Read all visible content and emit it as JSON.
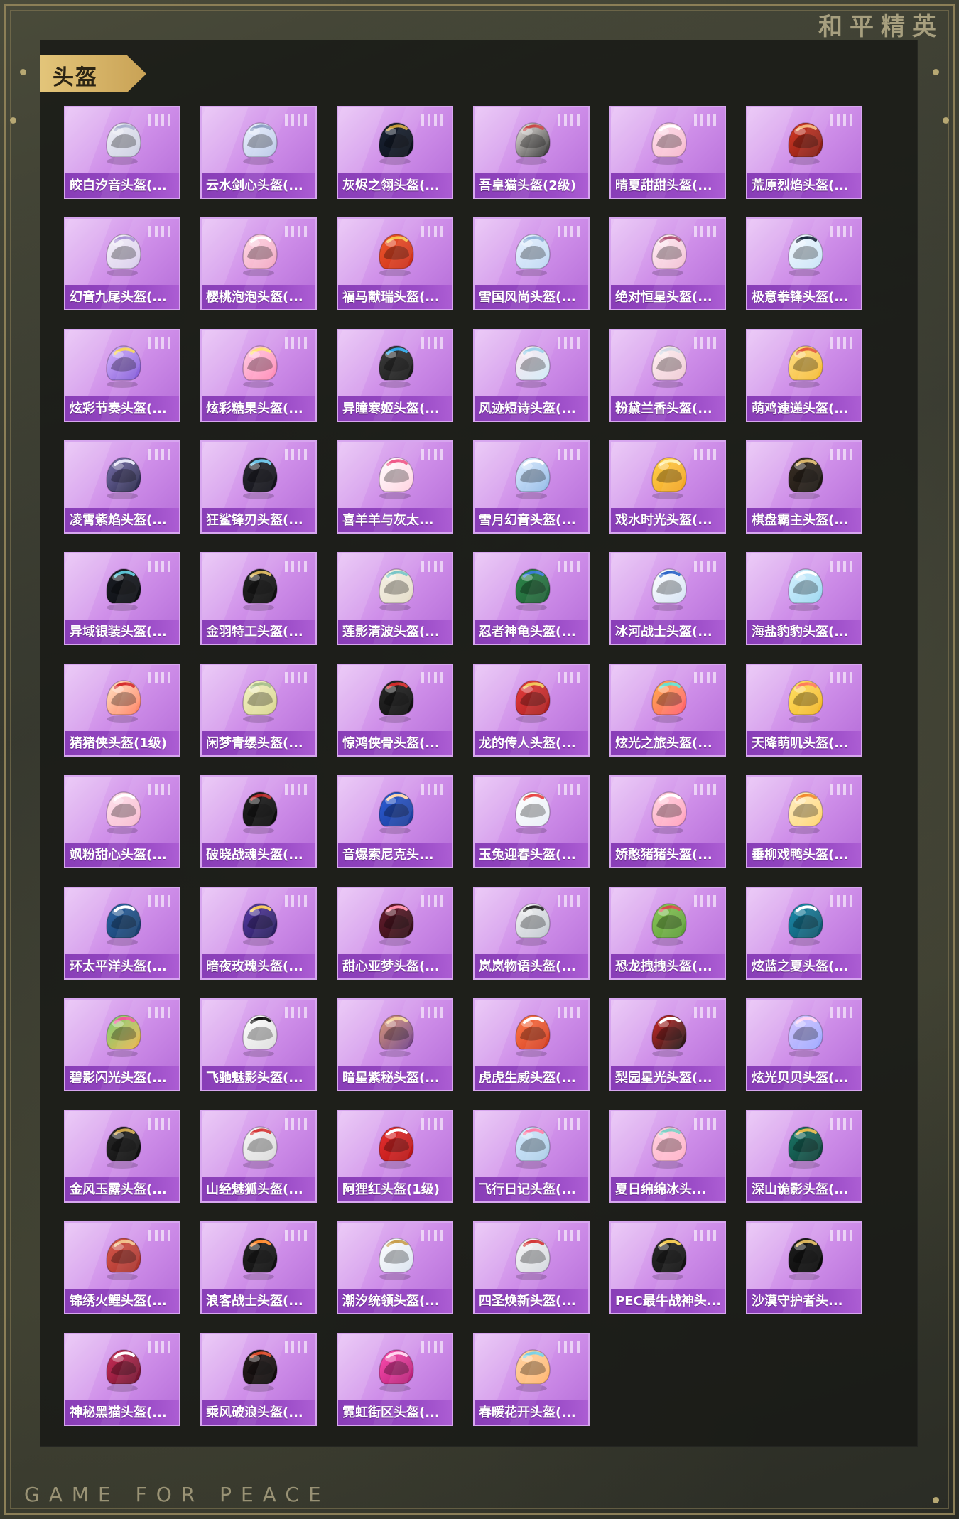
{
  "brand": {
    "title_cn": "和平精英",
    "footer_en": "GAME FOR PEACE"
  },
  "section": {
    "title": "头盔"
  },
  "cards": [
    {
      "name": "皎白汐音头盔(...",
      "icon": "helmet-icon",
      "c1": "#f0f0f6",
      "c2": "#c8cce0",
      "acc": "#aab2d0"
    },
    {
      "name": "云水剑心头盔(...",
      "icon": "helmet-icon",
      "c1": "#eef3ff",
      "c2": "#b7c6e6",
      "acc": "#8da0c4"
    },
    {
      "name": "灰烬之翎头盔(...",
      "icon": "helmet-icon",
      "c1": "#1b2436",
      "c2": "#0a0f18",
      "acc": "#c49a3c"
    },
    {
      "name": "吾皇猫头盔(2级)",
      "icon": "helmet-icon",
      "c1": "#f3eee9",
      "c2": "#2b2b2b",
      "acc": "#c94949"
    },
    {
      "name": "晴夏甜甜头盔(...",
      "icon": "helmet-icon",
      "c1": "#ffe1ec",
      "c2": "#f6b5cb",
      "acc": "#ffffff"
    },
    {
      "name": "荒原烈焰头盔(...",
      "icon": "helmet-icon",
      "c1": "#d93a26",
      "c2": "#7a1a12",
      "acc": "#f2b27a"
    },
    {
      "name": "幻音九尾头盔(...",
      "icon": "helmet-icon",
      "c1": "#f7f4fa",
      "c2": "#d6c9ea",
      "acc": "#a993d6"
    },
    {
      "name": "樱桃泡泡头盔(...",
      "icon": "helmet-icon",
      "c1": "#ffd9e6",
      "c2": "#f2a5c1",
      "acc": "#ffffff"
    },
    {
      "name": "福马献瑞头盔(...",
      "icon": "helmet-icon",
      "c1": "#ef5a2e",
      "c2": "#c92a16",
      "acc": "#f6c34a"
    },
    {
      "name": "雪国风尚头盔(...",
      "icon": "helmet-icon",
      "c1": "#eaf3ff",
      "c2": "#bcd6f3",
      "acc": "#8fb2d9"
    },
    {
      "name": "绝对恒星头盔(...",
      "icon": "helmet-icon",
      "c1": "#fff0f6",
      "c2": "#f2bed2",
      "acc": "#b04f73"
    },
    {
      "name": "极意拳锋头盔(...",
      "icon": "helmet-icon",
      "c1": "#f5faff",
      "c2": "#c7e3f7",
      "acc": "#1b2b3e"
    },
    {
      "name": "炫彩节奏头盔(...",
      "icon": "helmet-icon",
      "c1": "#d7b7ff",
      "c2": "#7f56d6",
      "acc": "#f6d55b"
    },
    {
      "name": "炫彩糖果头盔(...",
      "icon": "helmet-icon",
      "c1": "#ffd0e6",
      "c2": "#ff86b4",
      "acc": "#ffe17a"
    },
    {
      "name": "异瞳寒姬头盔(...",
      "icon": "helmet-icon",
      "c1": "#3f3f3f",
      "c2": "#161616",
      "acc": "#2fa7e8"
    },
    {
      "name": "风迹短诗头盔(...",
      "icon": "helmet-icon",
      "c1": "#ffe9f0",
      "c2": "#cfeaf7",
      "acc": "#9fd2ea"
    },
    {
      "name": "粉黛兰香头盔(...",
      "icon": "helmet-icon",
      "c1": "#fff3f3",
      "c2": "#efc7d3",
      "acc": "#d5dbe6"
    },
    {
      "name": "萌鸡速递头盔(...",
      "icon": "helmet-icon",
      "c1": "#ffe08a",
      "c2": "#f5b92f",
      "acc": "#e45b3a"
    },
    {
      "name": "凌霄紫焰头盔(...",
      "icon": "helmet-icon",
      "c1": "#7c74b0",
      "c2": "#242444",
      "acc": "#e7e7f7"
    },
    {
      "name": "狂鲨锋刃头盔(...",
      "icon": "helmet-icon",
      "c1": "#2b2b33",
      "c2": "#0f0f16",
      "acc": "#6ac2e8"
    },
    {
      "name": "喜羊羊与灰太...",
      "icon": "helmet-icon",
      "c1": "#ffffff",
      "c2": "#ffd1df",
      "acc": "#f05a8a"
    },
    {
      "name": "雪月幻音头盔(...",
      "icon": "helmet-icon",
      "c1": "#dfefff",
      "c2": "#8fb7e6",
      "acc": "#ffffff"
    },
    {
      "name": "戏水时光头盔(...",
      "icon": "helmet-icon",
      "c1": "#ffd24a",
      "c2": "#f2a11f",
      "acc": "#fff2b0"
    },
    {
      "name": "棋盘霸主头盔(...",
      "icon": "helmet-icon",
      "c1": "#3b3026",
      "c2": "#181410",
      "acc": "#d8b46a"
    },
    {
      "name": "异域银装头盔(...",
      "icon": "helmet-icon",
      "c1": "#1c1f26",
      "c2": "#0b0d11",
      "acc": "#58c1d3"
    },
    {
      "name": "金羽特工头盔(...",
      "icon": "helmet-icon",
      "c1": "#262626",
      "c2": "#0c0c0c",
      "acc": "#d6b25a"
    },
    {
      "name": "莲影清波头盔(...",
      "icon": "helmet-icon",
      "c1": "#f6f2e6",
      "c2": "#e3dbc6",
      "acc": "#7ac6c7"
    },
    {
      "name": "忍者神龟头盔(...",
      "icon": "helmet-icon",
      "c1": "#2e8b4c",
      "c2": "#1e5a34",
      "acc": "#3a7bd5"
    },
    {
      "name": "冰河战士头盔(...",
      "icon": "helmet-icon",
      "c1": "#ffffff",
      "c2": "#d3e2f4",
      "acc": "#2f67c9"
    },
    {
      "name": "海盐豹豹头盔(...",
      "icon": "helmet-icon",
      "c1": "#d7f2ff",
      "c2": "#98d6f0",
      "acc": "#ffffff"
    },
    {
      "name": "猪猪侠头盔(1级)",
      "icon": "helmet-icon",
      "c1": "#ffe6c7",
      "c2": "#ff7c5c",
      "acc": "#d62e2e"
    },
    {
      "name": "闲梦青缨头盔(...",
      "icon": "helmet-icon",
      "c1": "#f5f3c9",
      "c2": "#d7d48a",
      "acc": "#a7c08a"
    },
    {
      "name": "惊鸿侠骨头盔(...",
      "icon": "helmet-icon",
      "c1": "#2a2a2a",
      "c2": "#0c0c0c",
      "acc": "#cf2b2b"
    },
    {
      "name": "龙的传人头盔(...",
      "icon": "helmet-icon",
      "c1": "#e83f3f",
      "c2": "#a61c1c",
      "acc": "#f0c65a"
    },
    {
      "name": "炫光之旅头盔(...",
      "icon": "helmet-icon",
      "c1": "#ffb14d",
      "c2": "#ff5a6e",
      "acc": "#67e0d0"
    },
    {
      "name": "天降萌叽头盔(...",
      "icon": "helmet-icon",
      "c1": "#ffe46a",
      "c2": "#f2b322",
      "acc": "#ff7e5a"
    },
    {
      "name": "飒粉甜心头盔(...",
      "icon": "helmet-icon",
      "c1": "#ffe3ec",
      "c2": "#f7b8cf",
      "acc": "#ffffff"
    },
    {
      "name": "破晓战魂头盔(...",
      "icon": "helmet-icon",
      "c1": "#232323",
      "c2": "#090909",
      "acc": "#b92a2a"
    },
    {
      "name": "音爆索尼克头...",
      "icon": "helmet-icon",
      "c1": "#2d5ed8",
      "c2": "#1a3a93",
      "acc": "#ffd4a6"
    },
    {
      "name": "玉兔迎春头盔(...",
      "icon": "helmet-icon",
      "c1": "#ffffff",
      "c2": "#e7eef6",
      "acc": "#e84545"
    },
    {
      "name": "娇憨猪猪头盔(...",
      "icon": "helmet-icon",
      "c1": "#ffd7e2",
      "c2": "#ff9dbb",
      "acc": "#ffffff"
    },
    {
      "name": "垂柳戏鸭头盔(...",
      "icon": "helmet-icon",
      "c1": "#fff0c9",
      "c2": "#ffd36a",
      "acc": "#f28a2f"
    },
    {
      "name": "环太平洋头盔(...",
      "icon": "helmet-icon",
      "c1": "#2c66a6",
      "c2": "#163a66",
      "acc": "#ffffff"
    },
    {
      "name": "暗夜玫瑰头盔(...",
      "icon": "helmet-icon",
      "c1": "#5a3da8",
      "c2": "#221a55",
      "acc": "#f6c95b"
    },
    {
      "name": "甜心亚梦头盔(...",
      "icon": "helmet-icon",
      "c1": "#6b1e2f",
      "c2": "#2a0c13",
      "acc": "#ff8ca7"
    },
    {
      "name": "岚岚物语头盔(...",
      "icon": "helmet-icon",
      "c1": "#f4f4f4",
      "c2": "#bfc6ce",
      "acc": "#2b2b2b"
    },
    {
      "name": "恐龙拽拽头盔(...",
      "icon": "helmet-icon",
      "c1": "#8cc85a",
      "c2": "#5a9a35",
      "acc": "#d94a4a"
    },
    {
      "name": "炫蓝之夏头盔(...",
      "icon": "helmet-icon",
      "c1": "#1c8fb0",
      "c2": "#0e4f64",
      "acc": "#ffffff"
    },
    {
      "name": "碧影闪光头盔(...",
      "icon": "helmet-icon",
      "c1": "#7ad07a",
      "c2": "#f0b34a",
      "acc": "#f05a9a"
    },
    {
      "name": "飞驰魅影头盔(...",
      "icon": "helmet-icon",
      "c1": "#ffffff",
      "c2": "#dcdcdc",
      "acc": "#121212"
    },
    {
      "name": "暗星紫秘头盔(...",
      "icon": "helmet-icon",
      "c1": "#e0a07a",
      "c2": "#6b3c89",
      "acc": "#f3d39a"
    },
    {
      "name": "虎虎生威头盔(...",
      "icon": "helmet-icon",
      "c1": "#ff7b4a",
      "c2": "#d13a1f",
      "acc": "#ffffff"
    },
    {
      "name": "梨园星光头盔(...",
      "icon": "helmet-icon",
      "c1": "#d52b2b",
      "c2": "#151515",
      "acc": "#ffffff"
    },
    {
      "name": "炫光贝贝头盔(...",
      "icon": "helmet-icon",
      "c1": "#d6c7ff",
      "c2": "#9aa6ff",
      "acc": "#ffd2f3"
    },
    {
      "name": "金风玉露头盔(...",
      "icon": "helmet-icon",
      "c1": "#2b2b2b",
      "c2": "#0b0b0b",
      "acc": "#caa24a"
    },
    {
      "name": "山经魅狐头盔(...",
      "icon": "helmet-icon",
      "c1": "#f7f7f7",
      "c2": "#d9d9d9",
      "acc": "#d63a3a"
    },
    {
      "name": "阿狸红头盔(1级)",
      "icon": "helmet-icon",
      "c1": "#e83232",
      "c2": "#b31212",
      "acc": "#ffffff"
    },
    {
      "name": "飞行日记头盔(...",
      "icon": "helmet-icon",
      "c1": "#d7ecff",
      "c2": "#a9cbe6",
      "acc": "#ff7fa8"
    },
    {
      "name": "夏日绵绵冰头...",
      "icon": "helmet-icon",
      "c1": "#ffd2df",
      "c2": "#ffb0c7",
      "acc": "#7ed1c6"
    },
    {
      "name": "深山诡影头盔(...",
      "icon": "helmet-icon",
      "c1": "#1b7b6b",
      "c2": "#0f3b34",
      "acc": "#e0b84a"
    },
    {
      "name": "锦绣火鲤头盔(...",
      "icon": "helmet-icon",
      "c1": "#d85a4c",
      "c2": "#a52f2a",
      "acc": "#f2c08a"
    },
    {
      "name": "浪客战士头盔(...",
      "icon": "helmet-icon",
      "c1": "#262626",
      "c2": "#0c0c0c",
      "acc": "#ff8a2f"
    },
    {
      "name": "潮汐统领头盔(...",
      "icon": "helmet-icon",
      "c1": "#ffffff",
      "c2": "#d9e3ef",
      "acc": "#c9a050"
    },
    {
      "name": "四圣焕新头盔(...",
      "icon": "helmet-icon",
      "c1": "#f7f7f7",
      "c2": "#d2d6dc",
      "acc": "#d33a3a"
    },
    {
      "name": "PEC最牛战神头...",
      "icon": "helmet-icon",
      "c1": "#2c2c2c",
      "c2": "#0e0e0e",
      "acc": "#f2c84d"
    },
    {
      "name": "沙漠守护者头...",
      "icon": "helmet-icon",
      "c1": "#1f1f1f",
      "c2": "#070707",
      "acc": "#d8b15a"
    },
    {
      "name": "神秘黑猫头盔(...",
      "icon": "helmet-icon",
      "c1": "#cf2f5a",
      "c2": "#6a102b",
      "acc": "#ffffff"
    },
    {
      "name": "乘风破浪头盔(...",
      "icon": "helmet-icon",
      "c1": "#2a1f1f",
      "c2": "#0c0909",
      "acc": "#d94b2b"
    },
    {
      "name": "霓虹街区头盔(...",
      "icon": "helmet-icon",
      "c1": "#ff4fb1",
      "c2": "#b11c73",
      "acc": "#ffd2ee"
    },
    {
      "name": "春暖花开头盔(...",
      "icon": "helmet-icon",
      "c1": "#ffd5a6",
      "c2": "#ffb36a",
      "acc": "#7bd1e6"
    }
  ]
}
